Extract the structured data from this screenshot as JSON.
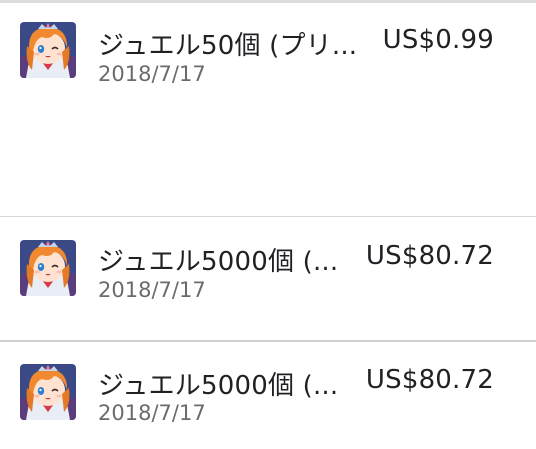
{
  "purchases": [
    {
      "title": "ジュエル50個 (プリ...",
      "date": "2018/7/17",
      "price": "US$0.99",
      "icon": "game-character-icon"
    },
    {
      "title": "ジュエル5000個 (...",
      "date": "2018/7/17",
      "price": "US$80.72",
      "icon": "game-character-icon"
    },
    {
      "title": "ジュエル5000個 (...",
      "date": "2018/7/17",
      "price": "US$80.72",
      "icon": "game-character-icon"
    }
  ],
  "colors": {
    "text_primary": "#202124",
    "text_secondary": "#6b6b6b",
    "divider": "#d8d8d8"
  }
}
